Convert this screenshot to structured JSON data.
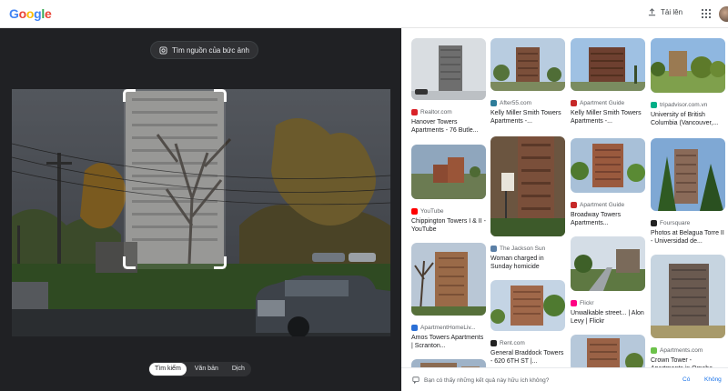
{
  "header": {
    "logo_letters": [
      {
        "ch": "G",
        "color": "#4285F4"
      },
      {
        "ch": "o",
        "color": "#EA4335"
      },
      {
        "ch": "o",
        "color": "#FBBC05"
      },
      {
        "ch": "g",
        "color": "#4285F4"
      },
      {
        "ch": "l",
        "color": "#34A853"
      },
      {
        "ch": "e",
        "color": "#EA4335"
      }
    ],
    "upload_label": "Tải lên",
    "upload_icon": "upload-icon",
    "apps_icon": "apps-grid-icon"
  },
  "lens": {
    "find_source_label": "Tìm nguồn của bức ảnh",
    "find_source_icon": "lens-search-icon",
    "modes": [
      "Tìm kiếm",
      "Văn bản",
      "Dịch"
    ],
    "active_mode": "Tìm kiếm"
  },
  "results": [
    {
      "source": "Realtor.com",
      "title": "Hanover Towers Apartments - 76 Butle...",
      "fav": "#d92228"
    },
    {
      "source": "After55.com",
      "title": "Kelly Miller Smith Towers Apartments -...",
      "fav": "#2e7d9a"
    },
    {
      "source": "Apartment Guide",
      "title": "Kelly Miller Smith Towers Apartments -...",
      "fav": "#c62828"
    },
    {
      "source": "tripadvisor.com.vn",
      "title": "University of British Columbia (Vancouver,...",
      "fav": "#00af87"
    },
    {
      "source": "YouTube",
      "title": "Chippington Towers I & II - YouTube",
      "fav": "#ff0000"
    },
    {
      "source": "The Jackson Sun",
      "title": "Woman charged in Sunday homicide",
      "fav": "#5b7fa6"
    },
    {
      "source": "Apartment Guide",
      "title": "Broadway Towers Apartments...",
      "fav": "#c62828"
    },
    {
      "source": "Foursquare",
      "title": "Photos at Belagua Torre II - Universidad de...",
      "fav": "#222222"
    },
    {
      "source": "ApartmentHomeLiv...",
      "title": "Amos Towers Apartments | Scranton...",
      "fav": "#2a6fd6"
    },
    {
      "source": "Flickr",
      "title": "Unwalkable street... | Alon Levy | Flickr",
      "fav": "#ff0084"
    },
    {
      "source": "Rent.com",
      "title": "General Braddock Towers - 620 6TH ST |...",
      "fav": "#222222"
    },
    {
      "source": "Apartments.com",
      "title": "Crown Tower - Apartments in Omaha,...",
      "fav": "#6cc24a"
    }
  ],
  "feedback": {
    "question": "Bạn có thấy những kết quả này hữu ích không?",
    "yes": "Có",
    "no": "Không",
    "icon": "feedback-icon"
  }
}
